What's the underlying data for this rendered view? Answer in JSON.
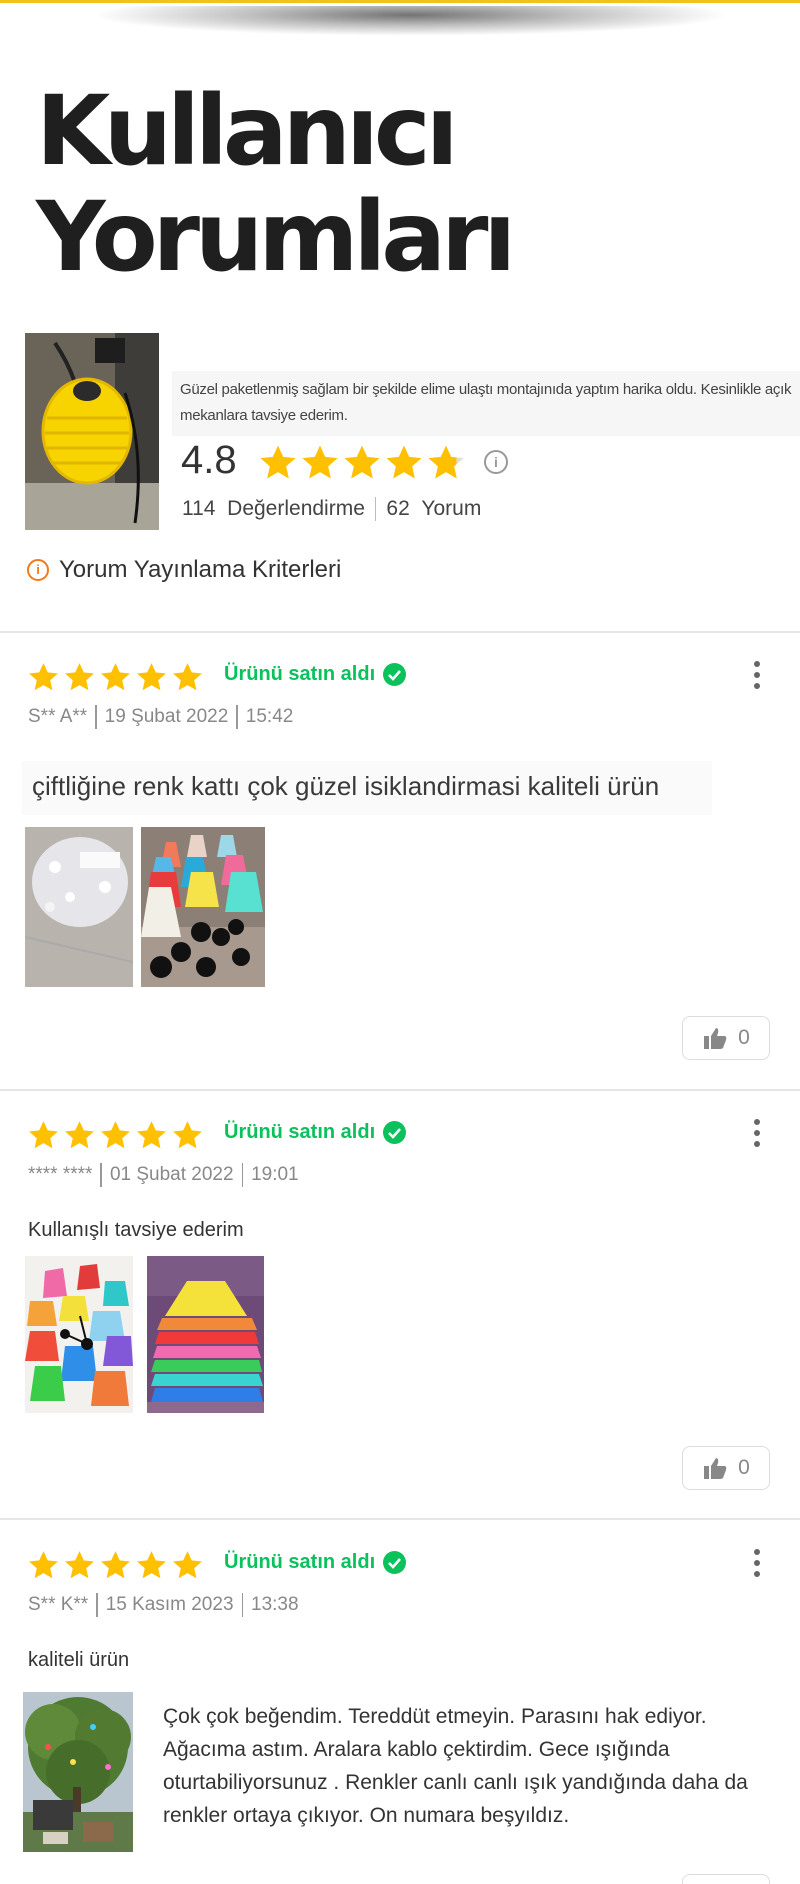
{
  "header": {
    "title_line1": "Kullanıcı",
    "title_line2": "Yorumları"
  },
  "summary": {
    "quote": "Güzel paketlenmiş sağlam bir şekilde elime ulaştı montajınıda yaptım harika oldu. Kesinlikle açık mekanlara tavsiye ederim.",
    "score": "4.8",
    "rating_count": "114",
    "rating_label": "Değerlendirme",
    "review_count": "62",
    "review_label": "Yorum",
    "criteria_label": "Yorum Yayınlama Kriterleri",
    "star_fill": [
      1,
      1,
      1,
      1,
      0.8
    ]
  },
  "reviews": [
    {
      "stars": 5,
      "bought_label": "Ürünü satın aldı",
      "author": "S** A**",
      "date": "19 Şubat 2022",
      "time": "15:42",
      "comment": "çiftliğine renk kattı çok güzel isiklandirmasi kaliteli ürün",
      "likes": "0"
    },
    {
      "stars": 5,
      "bought_label": "Ürünü satın aldı",
      "author": "**** ****",
      "date": "01 Şubat 2022",
      "time": "19:01",
      "comment": "Kullanışlı tavsiye ederim",
      "likes": "0"
    },
    {
      "stars": 5,
      "bought_label": "Ürünü satın aldı",
      "author": "S** K**",
      "date": "15 Kasım 2023",
      "time": "13:38",
      "comment": "kaliteli ürün",
      "photo_text": "Çok çok beğendim. Tereddüt etmeyin. Parasını hak ediyor. Ağacıma astım. Aralara kablo çektirdim. Gece ışığında oturtabiliyorsunuz . Renkler canlı canlı ışık yandığında daha da renkler ortaya çıkıyor. On numara beşyıldız."
    }
  ],
  "colors": {
    "star": "#ffc000",
    "green": "#0bc15c",
    "accent": "#f27a1a",
    "top_line": "#f2c21a"
  }
}
